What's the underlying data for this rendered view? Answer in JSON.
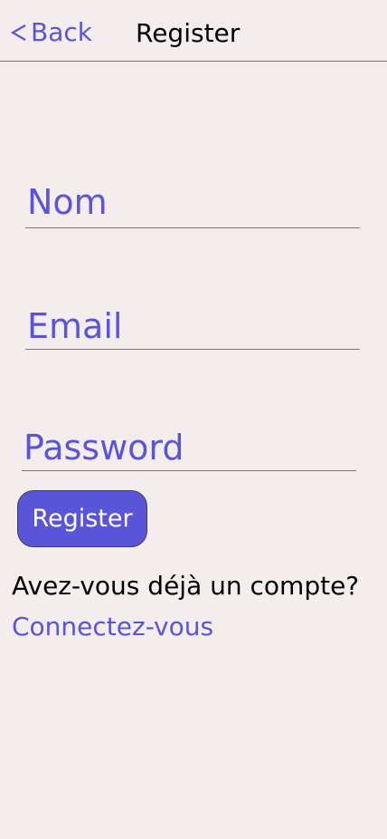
{
  "header": {
    "back_label": "Back",
    "title": "Register"
  },
  "form": {
    "name_placeholder": "Nom",
    "email_placeholder": "Email",
    "password_placeholder": "Password",
    "submit_label": "Register"
  },
  "footer": {
    "question": "Avez-vous déjà un compte?",
    "login_link": "Connectez-vous"
  },
  "colors": {
    "accent": "#5a55d8",
    "background": "#f3eded",
    "text": "#000000"
  },
  "icons": {
    "back": "chevron-left-icon"
  }
}
